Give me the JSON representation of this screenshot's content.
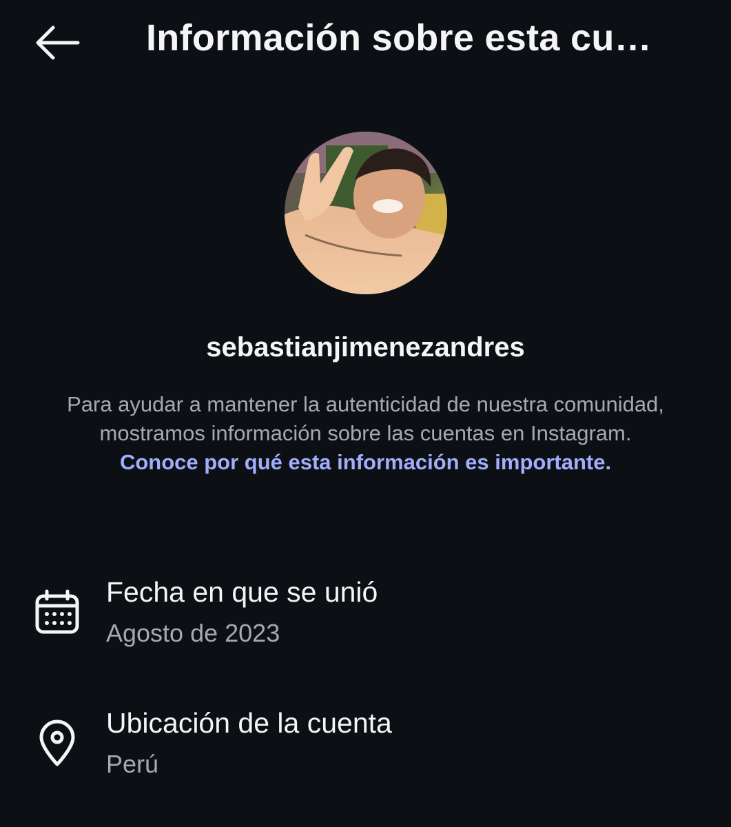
{
  "header": {
    "title": "Información sobre esta cu…",
    "back_icon": "arrow-left-icon"
  },
  "profile": {
    "username": "sebastianjimenezandres",
    "avatar_alt": "profile photo"
  },
  "description": {
    "text": "Para ayudar a mantener la autenticidad de nuestra comunidad, mostramos información sobre las cuentas en Instagram. ",
    "link_text": "Conoce por qué esta información es importante."
  },
  "details": [
    {
      "icon": "calendar-icon",
      "title": "Fecha en que se unió",
      "value": "Agosto de 2023"
    },
    {
      "icon": "location-pin-icon",
      "title": "Ubicación de la cuenta",
      "value": "Perú"
    }
  ],
  "colors": {
    "background": "#0c1014",
    "primary_text": "#f5f5f5",
    "secondary_text": "#a8a8ad",
    "link": "#a0aefc"
  }
}
